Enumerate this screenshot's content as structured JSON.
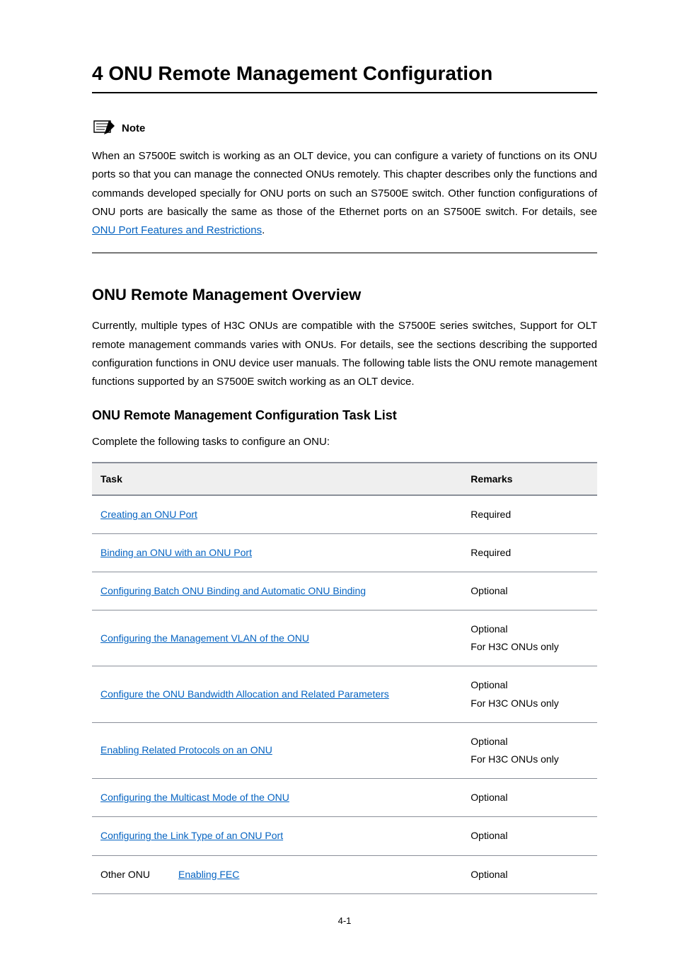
{
  "chapter_title": "4 ONU Remote Management Configuration",
  "note": {
    "label": "Note",
    "text_before_link": "When an S7500E switch is working as an OLT device, you can configure a variety of functions on its ONU ports  so that you can manage the connected ONUs remotely. This chapter describes only the functions and commands developed specially for ONU ports on such an S7500E switch. Other function configurations of ONU ports are basically the same as those of the Ethernet ports on an S7500E switch. For details, see ",
    "link_text": "ONU Port Features and Restrictions",
    "text_after_link": "."
  },
  "overview": {
    "heading": "ONU Remote Management Overview",
    "body": "Currently, multiple types of H3C ONUs are compatible with the S7500E series switches, Support for OLT remote management commands varies with ONUs. For details, see the sections describing the supported configuration functions in ONU device user manuals. The following table lists the ONU remote management functions supported by an S7500E switch working as an OLT device."
  },
  "task_list": {
    "heading": "ONU Remote Management Configuration Task List",
    "intro": "Complete the following tasks to configure an ONU:",
    "header_task": "Task",
    "header_remarks": "Remarks",
    "rows": [
      {
        "task": "Creating an ONU Port",
        "remarks": "Required",
        "span": 2
      },
      {
        "task": "Binding an ONU with an ONU Port",
        "remarks": "Required",
        "span": 2
      },
      {
        "task": "Configuring Batch ONU Binding and Automatic ONU Binding",
        "remarks": "Optional",
        "span": 2
      },
      {
        "task": "Configuring the Management VLAN of the ONU",
        "remarks": "Optional\nFor H3C ONUs only",
        "span": 2
      },
      {
        "task": "Configure the ONU Bandwidth Allocation and Related Parameters",
        "remarks": "Optional\nFor H3C ONUs only",
        "span": 2
      },
      {
        "task": "Enabling Related Protocols on an ONU",
        "remarks": "Optional\nFor H3C ONUs only",
        "span": 2
      },
      {
        "task": "Configuring the Multicast Mode of the ONU",
        "remarks": "Optional",
        "span": 2
      },
      {
        "task": "Configuring the Link Type of an ONU Port",
        "remarks": "Optional",
        "span": 2
      }
    ],
    "group_row": {
      "group_label": "Other ONU",
      "task": "Enabling FEC",
      "remarks": "Optional"
    }
  },
  "page_number": "4-1"
}
